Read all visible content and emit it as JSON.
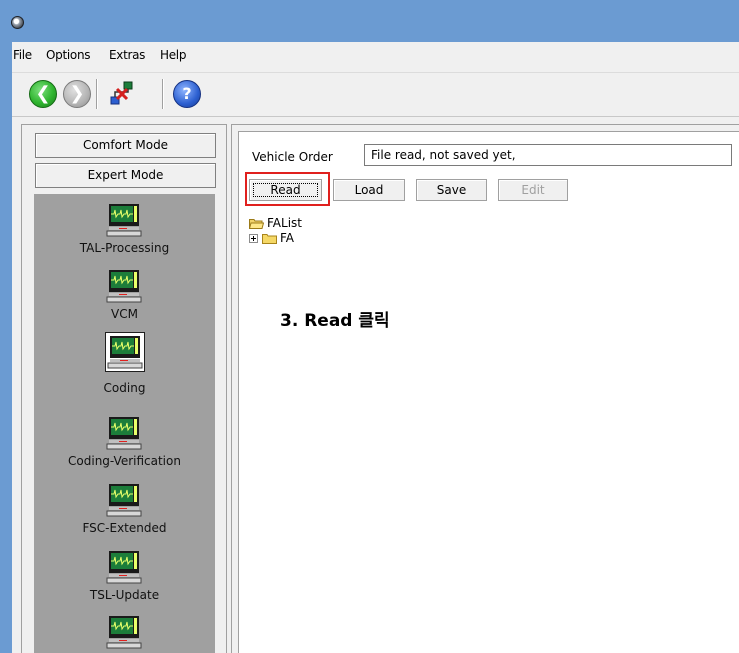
{
  "titlebar": {
    "app_icon": "app-globe-icon"
  },
  "menu": {
    "items": [
      "File",
      "Options",
      "Extras",
      "Help"
    ]
  },
  "toolbar": {
    "buttons": [
      {
        "name": "back",
        "icon": "back-arrow-icon",
        "enabled": true
      },
      {
        "name": "forward",
        "icon": "forward-arrow-icon",
        "enabled": false
      },
      {
        "name": "network",
        "icon": "network-icon",
        "enabled": true
      },
      {
        "name": "help",
        "icon": "help-icon",
        "enabled": true
      }
    ],
    "back_glyph": "❮",
    "forward_glyph": "❯",
    "help_glyph": "?"
  },
  "sidebar": {
    "comfort_mode": "Comfort Mode",
    "expert_mode": "Expert Mode",
    "items": [
      {
        "label": "TAL-Processing",
        "icon": "monitor-icon",
        "selected": false
      },
      {
        "label": "VCM",
        "icon": "monitor-icon",
        "selected": false
      },
      {
        "label": "Coding",
        "icon": "monitor-icon",
        "selected": true
      },
      {
        "label": "Coding-Verification",
        "icon": "monitor-icon",
        "selected": false
      },
      {
        "label": "FSC-Extended",
        "icon": "monitor-icon",
        "selected": false
      },
      {
        "label": "TSL-Update",
        "icon": "monitor-icon",
        "selected": false
      },
      {
        "label": "",
        "icon": "monitor-icon",
        "selected": false
      }
    ]
  },
  "main": {
    "vehicle_order_label": "Vehicle Order",
    "vehicle_order_value": "File read, not saved yet,",
    "buttons": {
      "read": "Read",
      "load": "Load",
      "save": "Save",
      "edit": "Edit"
    },
    "tree": {
      "root": "FAList",
      "child": "FA"
    },
    "annotation": "3. Read 클릭"
  },
  "colors": {
    "titlebar": "#6b9bd2",
    "sidebar_list": "#a0a0a0",
    "highlight": "#e0201e",
    "monitor_screen": "#1c7d3a",
    "monitor_wave": "#e8ff6a"
  }
}
